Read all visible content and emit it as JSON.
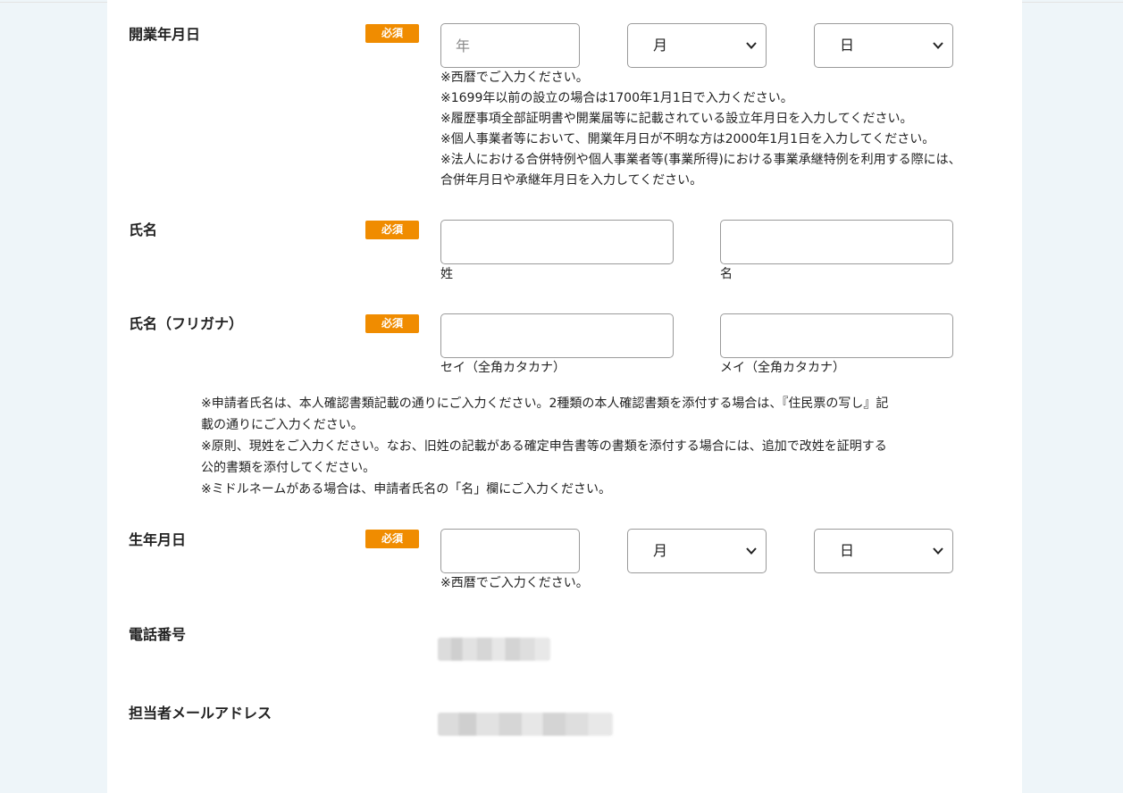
{
  "form": {
    "required_badge": "必須",
    "opening_date": {
      "label": "開業年月日",
      "year_placeholder": "年",
      "month_value": "月",
      "day_value": "日",
      "notes": [
        "※西暦でご入力ください。",
        "※1699年以前の設立の場合は1700年1月1日で入力ください。",
        "※履歴事項全部証明書や開業届等に記載されている設立年月日を入力してください。",
        "※個人事業者等において、開業年月日が不明な方は2000年1月1日を入力してください。",
        "※法人における合併特例や個人事業者等(事業所得)における事業承継特例を利用する際には、",
        "合併年月日や承継年月日を入力してください。"
      ]
    },
    "name": {
      "label": "氏名",
      "last_name_caption": "姓",
      "first_name_caption": "名"
    },
    "name_kana": {
      "label": "氏名（フリガナ）",
      "last_kana_caption": "セイ（全角カタカナ）",
      "first_kana_caption": "メイ（全角カタカナ）",
      "notes": [
        "※申請者氏名は、本人確認書類記載の通りにご入力ください。2種類の本人確認書類を添付する場合は、『住民票の写し』記",
        "載の通りにご入力ください。",
        "※原則、現姓をご入力ください。なお、旧姓の記載がある確定申告書等の書類を添付する場合には、追加で改姓を証明する",
        "公的書類を添付してください。",
        "※ミドルネームがある場合は、申請者氏名の「名」欄にご入力ください。"
      ]
    },
    "birth_date": {
      "label": "生年月日",
      "month_value": "月",
      "day_value": "日",
      "note": "※西暦でご入力ください。"
    },
    "phone": {
      "label": "電話番号"
    },
    "contact_email": {
      "label": "担当者メールアドレス"
    }
  },
  "colors": {
    "badge": "#f08c00",
    "background": "#eef5f9",
    "panel": "#ffffff"
  }
}
